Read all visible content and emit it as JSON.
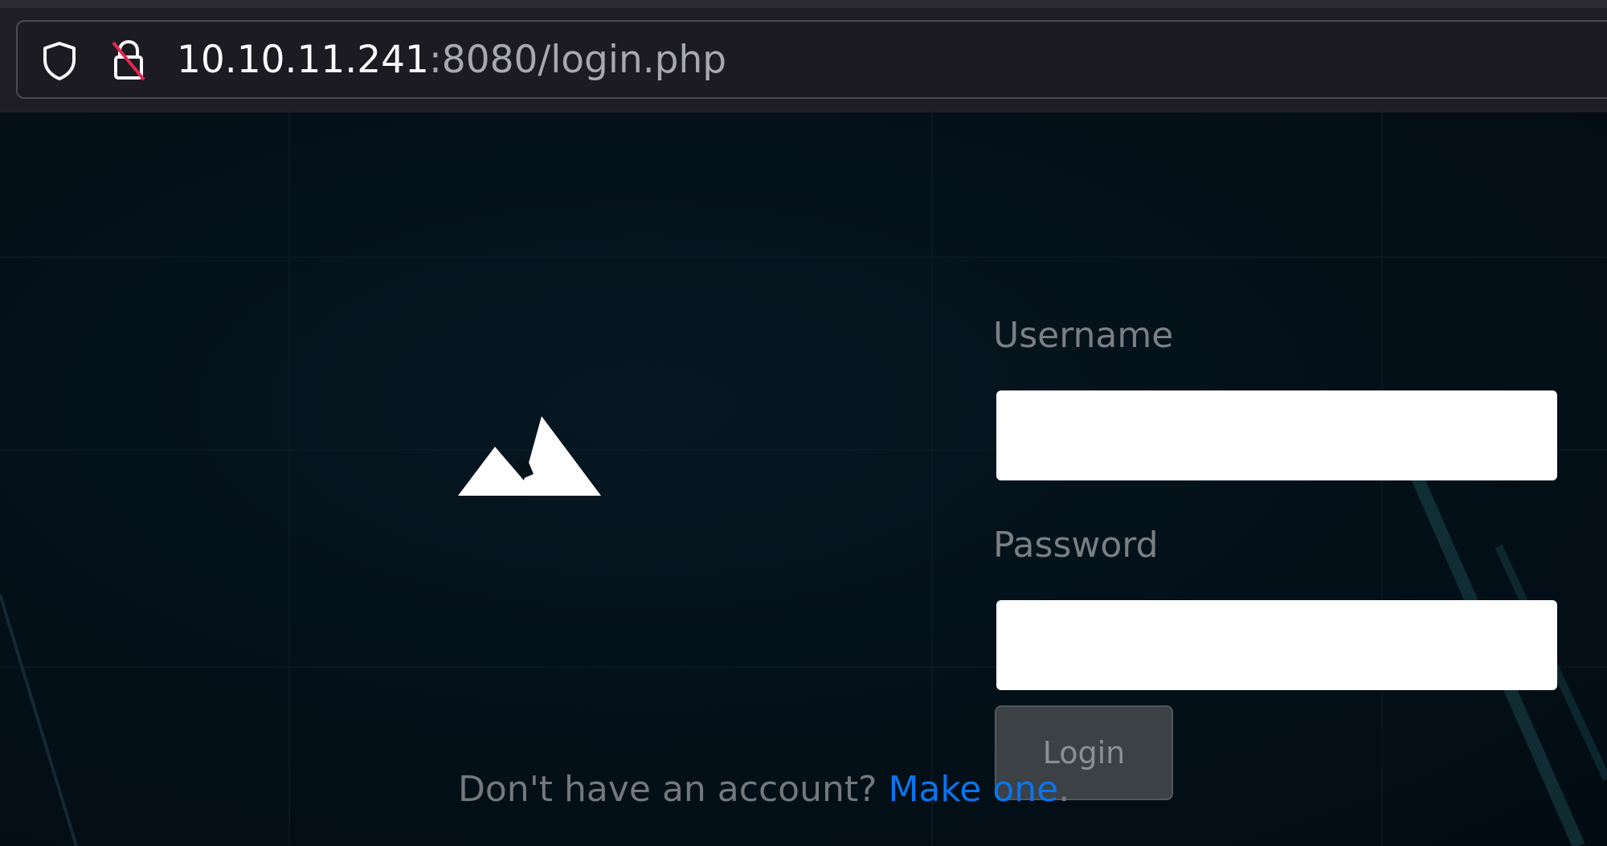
{
  "browser": {
    "url_host": "10.10.11.241",
    "url_path": ":8080/login.php",
    "icons": [
      "shield-icon",
      "insecure-lock-icon"
    ]
  },
  "login_form": {
    "username_label": "Username",
    "username_value": "",
    "password_label": "Password",
    "password_value": "",
    "login_label": "Login"
  },
  "signup": {
    "prompt": "Don't have an account? ",
    "link_label": "Make one",
    "suffix": "."
  },
  "colors": {
    "background": "#06121a",
    "link": "#0a74ec",
    "button": "#3c4145",
    "label": "#7a7f84"
  },
  "logo": {
    "icon": "mountain-logo-icon"
  }
}
